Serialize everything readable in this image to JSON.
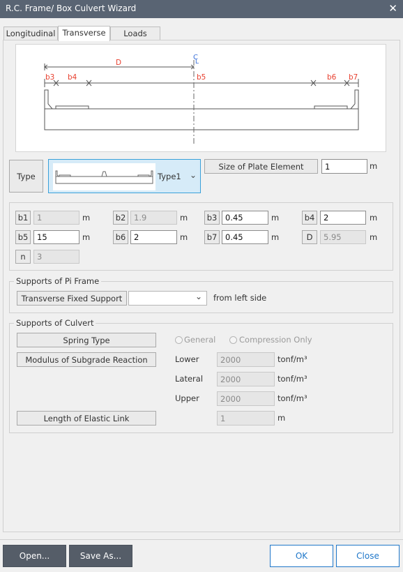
{
  "window": {
    "title": "R.C. Frame/ Box Culvert Wizard"
  },
  "tabs": [
    {
      "label": "Longitudinal"
    },
    {
      "label": "Transverse"
    },
    {
      "label": "Loads"
    }
  ],
  "drawing": {
    "labels": {
      "D": "D",
      "b3": "b3",
      "b4": "b4",
      "b5": "b5",
      "b6": "b6",
      "b7": "b7",
      "cl_top": "C",
      "cl_bottom": "L"
    },
    "colors": {
      "dim_label": "#e8402f",
      "centerline": "#3a6fd8",
      "lines": "#555555"
    }
  },
  "type_section": {
    "type_label": "Type",
    "selected": "Type1",
    "size_button": "Size of Plate Element",
    "size_value": "1",
    "size_unit": "m"
  },
  "params": [
    {
      "name": "b1",
      "value": "1",
      "unit": "m",
      "disabled": true
    },
    {
      "name": "b2",
      "value": "1.9",
      "unit": "m",
      "disabled": true
    },
    {
      "name": "b3",
      "value": "0.45",
      "unit": "m",
      "disabled": false
    },
    {
      "name": "b4",
      "value": "2",
      "unit": "m",
      "disabled": false
    },
    {
      "name": "b5",
      "value": "15",
      "unit": "m",
      "disabled": false
    },
    {
      "name": "b6",
      "value": "2",
      "unit": "m",
      "disabled": false
    },
    {
      "name": "b7",
      "value": "0.45",
      "unit": "m",
      "disabled": false
    },
    {
      "name": "D",
      "value": "5.95",
      "unit": "m",
      "disabled": true
    },
    {
      "name": "n",
      "value": "3",
      "unit": "",
      "disabled": true
    }
  ],
  "pi_frame": {
    "title": "Supports of Pi Frame",
    "button": "Transverse Fixed Support",
    "dropdown_value": "",
    "suffix": "from left side"
  },
  "culvert": {
    "title": "Supports of Culvert",
    "spring_button": "Spring Type",
    "radio_general": "General",
    "radio_compression": "Compression Only",
    "modulus_button": "Modulus of Subgrade Reaction",
    "lower_label": "Lower",
    "lower_value": "2000",
    "lateral_label": "Lateral",
    "lateral_value": "2000",
    "upper_label": "Upper",
    "upper_value": "2000",
    "pressure_unit": "tonf/m³",
    "elastic_button": "Length of Elastic Link",
    "elastic_value": "1",
    "elastic_unit": "m"
  },
  "footer": {
    "open": "Open...",
    "save_as": "Save As...",
    "ok": "OK",
    "close": "Close",
    "ok_border": "#1f77c9"
  }
}
